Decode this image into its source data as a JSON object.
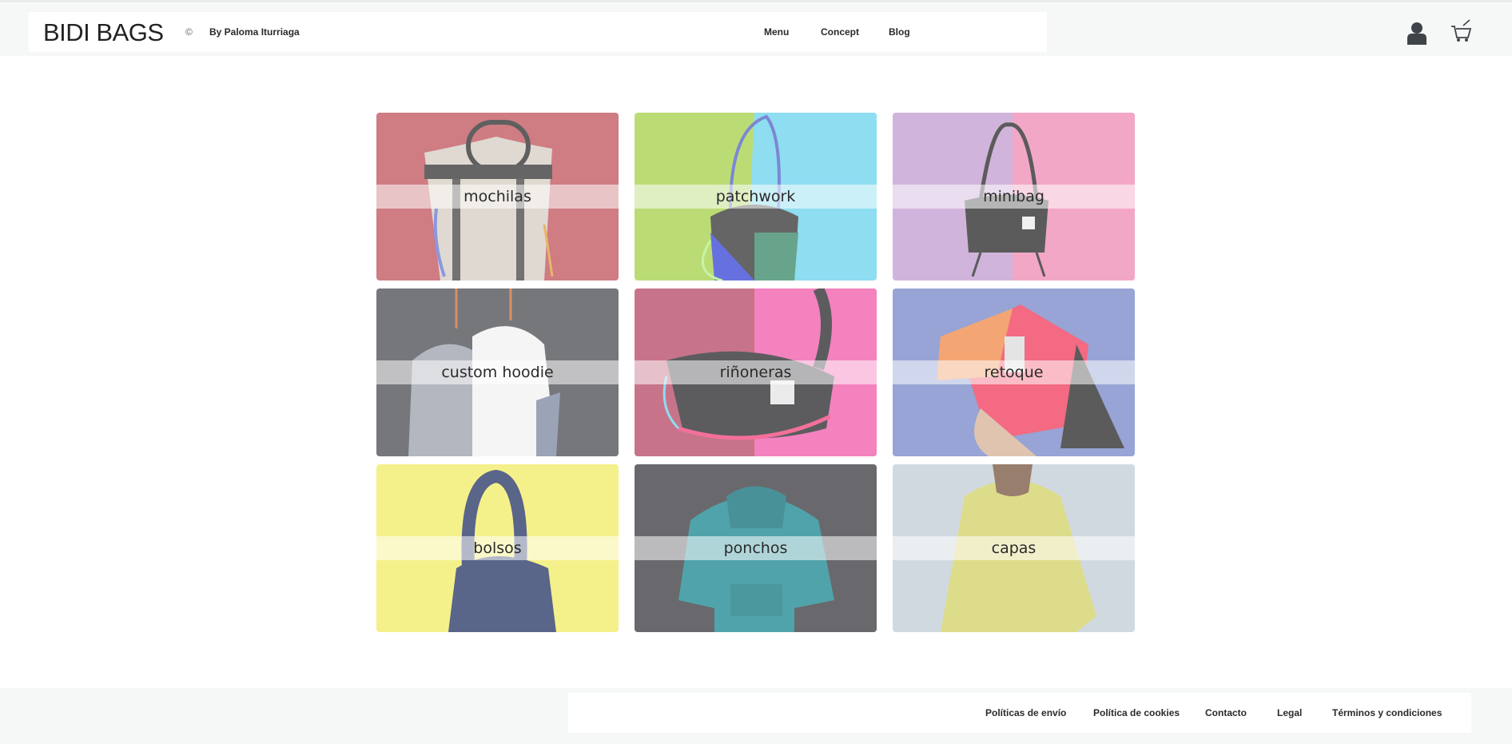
{
  "header": {
    "logo": "BIDI BAGS",
    "copyright_symbol": "©",
    "byline": "By Paloma Iturriaga",
    "nav": [
      "Menu",
      "Concept",
      "Blog"
    ],
    "icons": [
      "user-icon",
      "cart-icon"
    ]
  },
  "tiles": [
    {
      "label": "mochilas"
    },
    {
      "label": "patchwork"
    },
    {
      "label": "minibag"
    },
    {
      "label": "custom hoodie"
    },
    {
      "label": "riñoneras"
    },
    {
      "label": "retoque"
    },
    {
      "label": "bolsos"
    },
    {
      "label": "ponchos"
    },
    {
      "label": "capas"
    }
  ],
  "footer": {
    "links": [
      "Políticas de envío",
      "Política de cookies",
      "Contacto",
      "Legal",
      "Términos y condiciones"
    ]
  },
  "colors": {
    "header_bg": "#f6f7f7",
    "card_bg": "#ffffff",
    "text": "#2a2a2a"
  }
}
